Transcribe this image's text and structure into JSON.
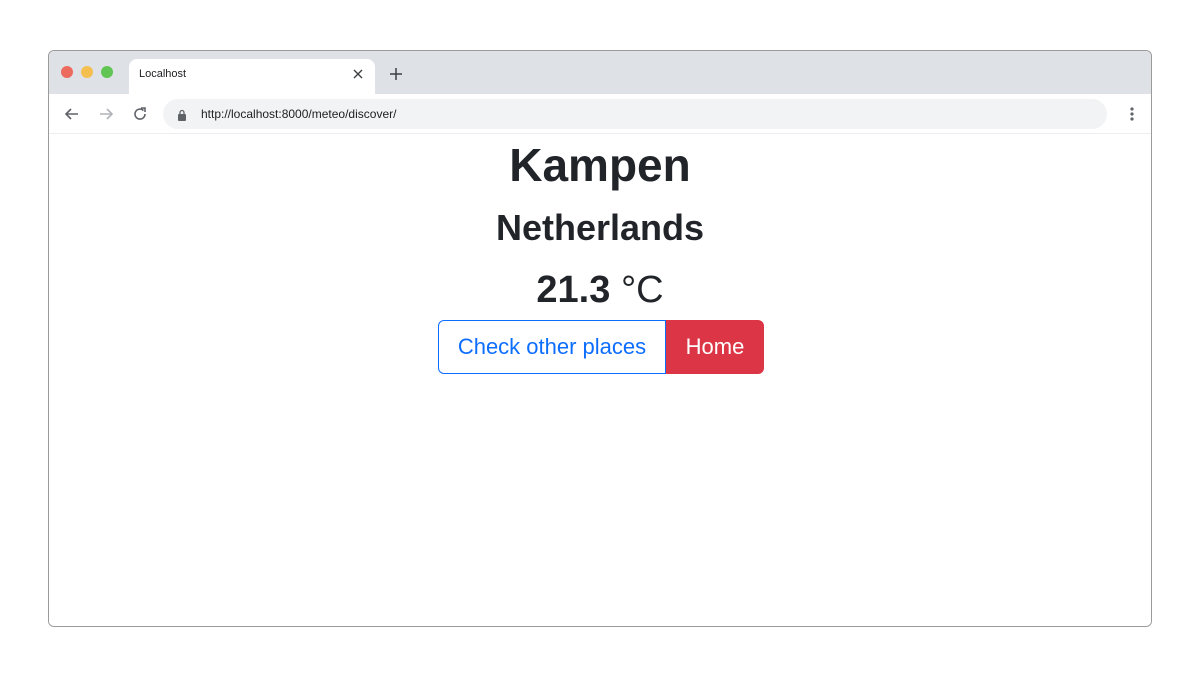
{
  "browser": {
    "tab_title": "Localhost",
    "url": "http://localhost:8000/meteo/discover/",
    "icons": [
      "close-icon",
      "plus-icon",
      "arrow-left-icon",
      "arrow-right-icon",
      "reload-icon",
      "lock-icon",
      "more-vert-icon"
    ]
  },
  "page": {
    "city": "Kampen",
    "country": "Netherlands",
    "temperature_value": "21.3",
    "temperature_unit": "°C",
    "buttons": {
      "check_other": "Check other places",
      "home": "Home"
    }
  },
  "colors": {
    "primary": "#0d6efd",
    "danger": "#dc3545",
    "text": "#212529",
    "tabstrip": "#dee1e6"
  }
}
